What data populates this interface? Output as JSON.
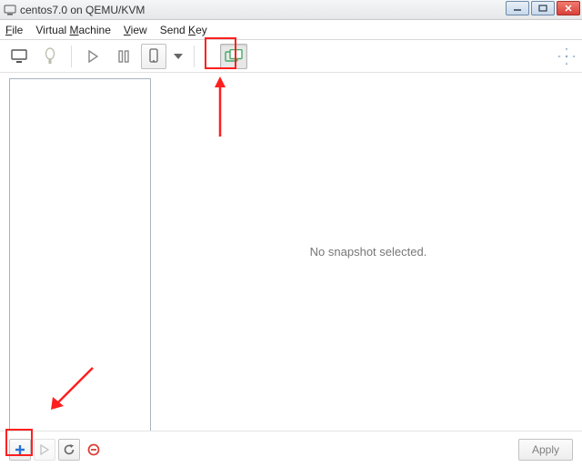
{
  "window": {
    "title": "centos7.0 on QEMU/KVM"
  },
  "menu": {
    "file": "File",
    "virtual_machine": "Virtual Machine",
    "view": "View",
    "send_key": "Send Key"
  },
  "toolbar": {
    "console_icon": "console-icon",
    "info_icon": "info-icon",
    "play_icon": "play-icon",
    "pause_icon": "pause-icon",
    "shutdown_icon": "shutdown-icon",
    "shutdown_dropdown_icon": "chevron-down-icon",
    "snapshots_icon": "snapshots-icon",
    "fullscreen_icon": "fullscreen-icon"
  },
  "detail": {
    "empty_text": "No snapshot selected."
  },
  "bottom": {
    "add_icon": "plus-icon",
    "run_icon": "play-icon",
    "refresh_icon": "refresh-icon",
    "delete_icon": "delete-icon",
    "apply_label": "Apply"
  },
  "win_controls": {
    "minimize": "minimize",
    "maximize": "maximize",
    "close": "close"
  }
}
